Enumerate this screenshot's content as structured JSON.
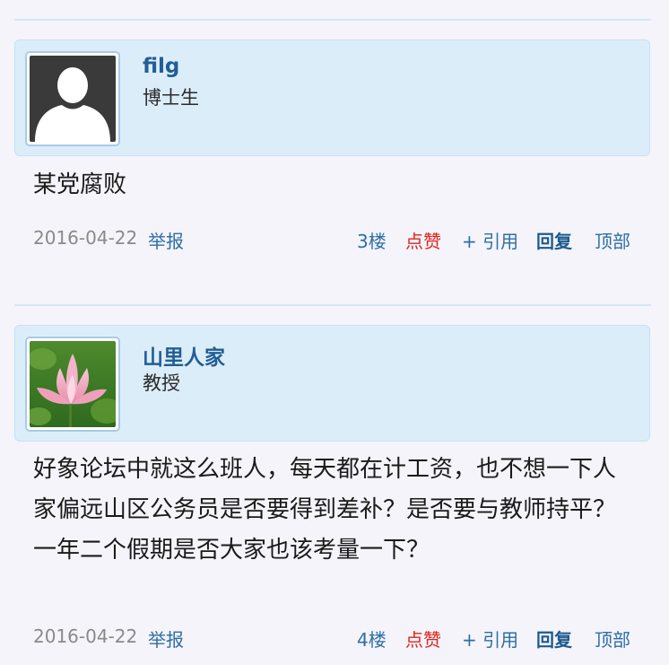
{
  "posts": [
    {
      "username": "filg",
      "user_title": "博士生",
      "avatar_icon": "default-user-avatar-icon",
      "content": "某党腐败",
      "date": "2016-04-22",
      "report_label": "举报",
      "floor": "3楼",
      "like_label": "点赞",
      "quote_label": "+ 引用",
      "reply_label": "回复",
      "top_label": "顶部"
    },
    {
      "username": "山里人家",
      "user_title": "教授",
      "avatar_icon": "lotus-flower-avatar-icon",
      "content": "好象论坛中就这么班人，每天都在计工资，也不想一下人家偏远山区公务员是否要得到差补？是否要与教师持平？一年二个假期是否大家也该考量一下？",
      "date": "2016-04-22",
      "report_label": "举报",
      "floor": "4楼",
      "like_label": "点赞",
      "quote_label": "+ 引用",
      "reply_label": "回复",
      "top_label": "顶部"
    }
  ],
  "colors": {
    "background": "#f4f4fa",
    "card_background": "#dcedfa",
    "username": "#225e93",
    "link": "#2e6ea5",
    "like": "#e0231d",
    "date": "#8a8a8a"
  }
}
